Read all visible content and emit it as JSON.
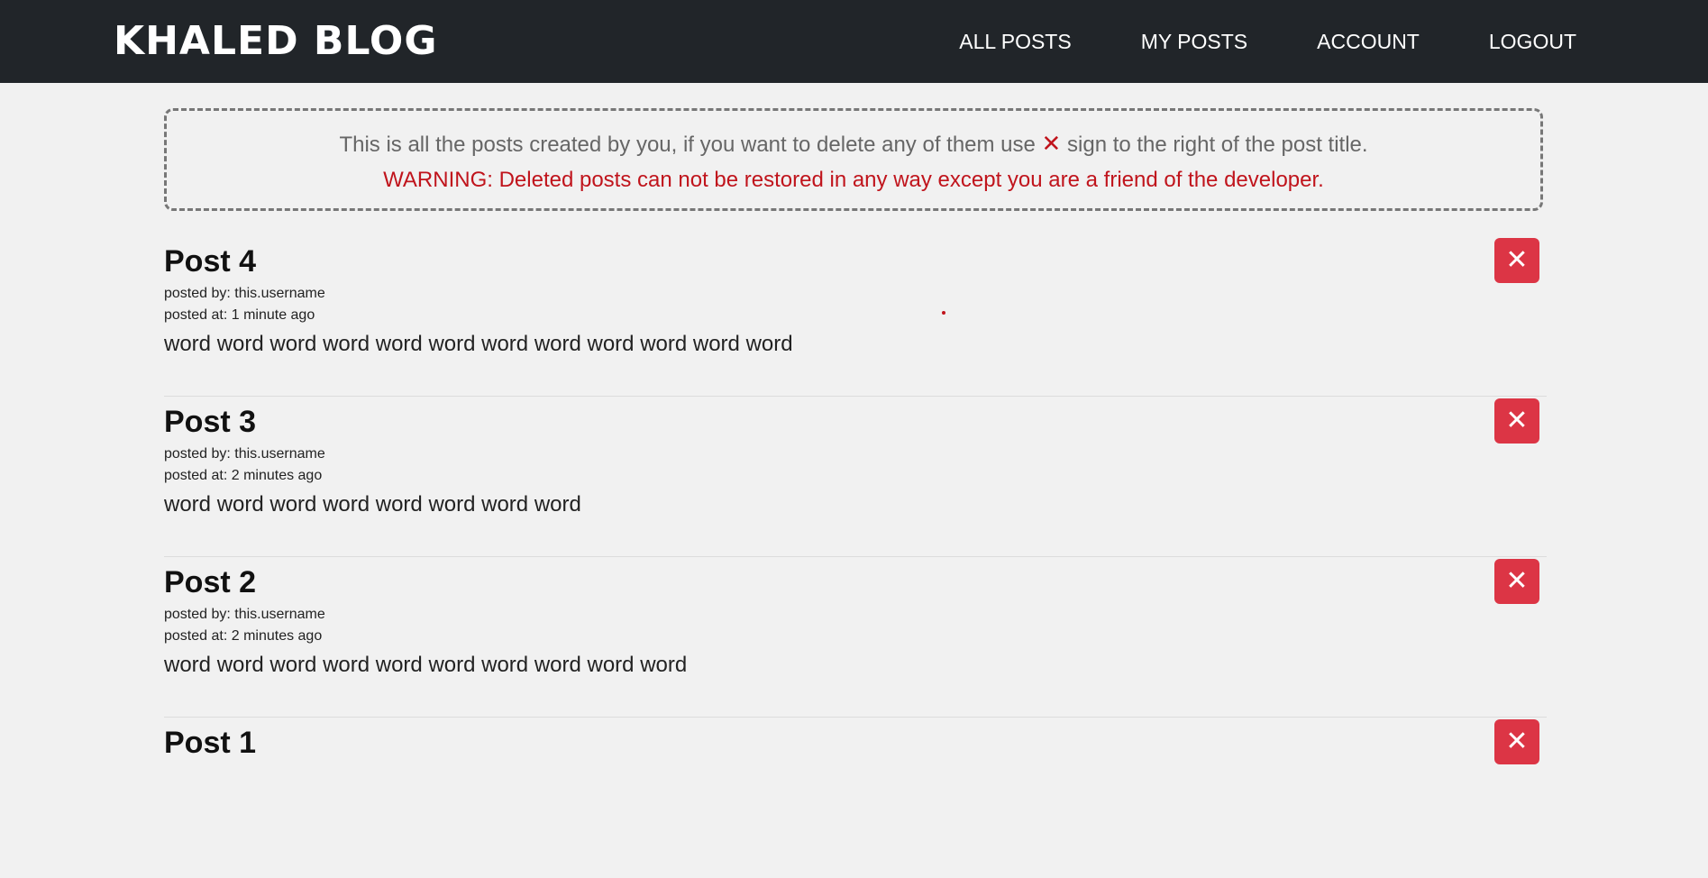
{
  "navbar": {
    "brand": "KHALED BLOG",
    "links": [
      {
        "label": "ALL POSTS"
      },
      {
        "label": "MY POSTS"
      },
      {
        "label": "ACCOUNT"
      },
      {
        "label": "LOGOUT"
      }
    ]
  },
  "notice": {
    "line1_before": "This is all the posts created by you, if you want to delete any of them use ",
    "x_glyph": "✕",
    "line1_after": " sign to the right of the post title.",
    "warning": "WARNING: Deleted posts can not be restored in any way except you are a friend of the developer."
  },
  "posts": [
    {
      "title": "Post 4",
      "posted_by": "posted by: this.username",
      "posted_at": "posted at: 1 minute ago",
      "body": "word word word word word word word word word word word word",
      "delete_glyph": "✕"
    },
    {
      "title": "Post 3",
      "posted_by": "posted by: this.username",
      "posted_at": "posted at: 2 minutes ago",
      "body": "word word word word word word word word",
      "delete_glyph": "✕"
    },
    {
      "title": "Post 2",
      "posted_by": "posted by: this.username",
      "posted_at": "posted at: 2 minutes ago",
      "body": "word word word word word word word word word word",
      "delete_glyph": "✕"
    },
    {
      "title": "Post 1",
      "posted_by": "",
      "posted_at": "",
      "body": "",
      "delete_glyph": "✕"
    }
  ],
  "colors": {
    "navbar_bg": "#212529",
    "page_bg": "#f1f1f1",
    "danger": "#dc3545",
    "warning_text": "#c0141c"
  },
  "icons": {
    "delete": "close-icon"
  }
}
